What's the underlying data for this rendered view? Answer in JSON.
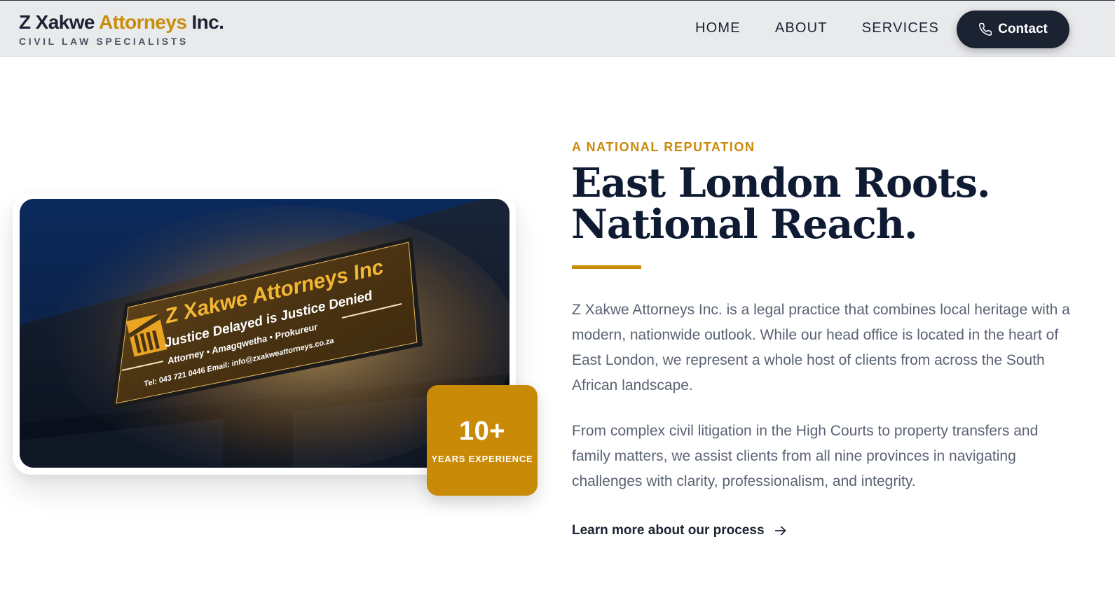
{
  "header": {
    "brand_name_1": "Z Xakwe",
    "brand_name_2": "Attorneys",
    "brand_name_3": "Inc.",
    "tagline": "CIVIL LAW SPECIALISTS",
    "nav": [
      "HOME",
      "ABOUT",
      "SERVICES"
    ],
    "contact_label": "Contact",
    "contact_icon": "phone-icon"
  },
  "hero_image": {
    "alt": "Illuminated Z Xakwe Attorneys Inc office sign at night",
    "sign_title": "Z Xakwe Attorneys Inc",
    "sign_motto": "Justice Delayed is Justice Denied",
    "sign_roles": "Attorney • Amagqwetha • Prokureur",
    "sign_contact": "Tel: 043 721 0446   Email: info@zxakweattorneys.co.za"
  },
  "badge": {
    "value": "10+",
    "label": "YEARS EXPERIENCE"
  },
  "content": {
    "eyebrow": "A NATIONAL REPUTATION",
    "headline_line1": "East London Roots.",
    "headline_line2": "National Reach.",
    "paragraph1": "Z Xakwe Attorneys Inc. is a legal practice that combines local heritage with a modern, nationwide outlook. While our head office is located in the heart of East London, we represent a whole host of clients from across the South African landscape.",
    "paragraph2": "From complex civil litigation in the High Courts to property transfers and family matters, we assist clients from all nine provinces in navigating challenges with clarity, professionalism, and integrity.",
    "link_label": "Learn more about our process",
    "link_icon": "arrow-right-icon"
  },
  "colors": {
    "navy": "#1b2333",
    "gold": "#c98a07",
    "body_text": "#5a6373",
    "header_bg": "#e9eaec"
  }
}
